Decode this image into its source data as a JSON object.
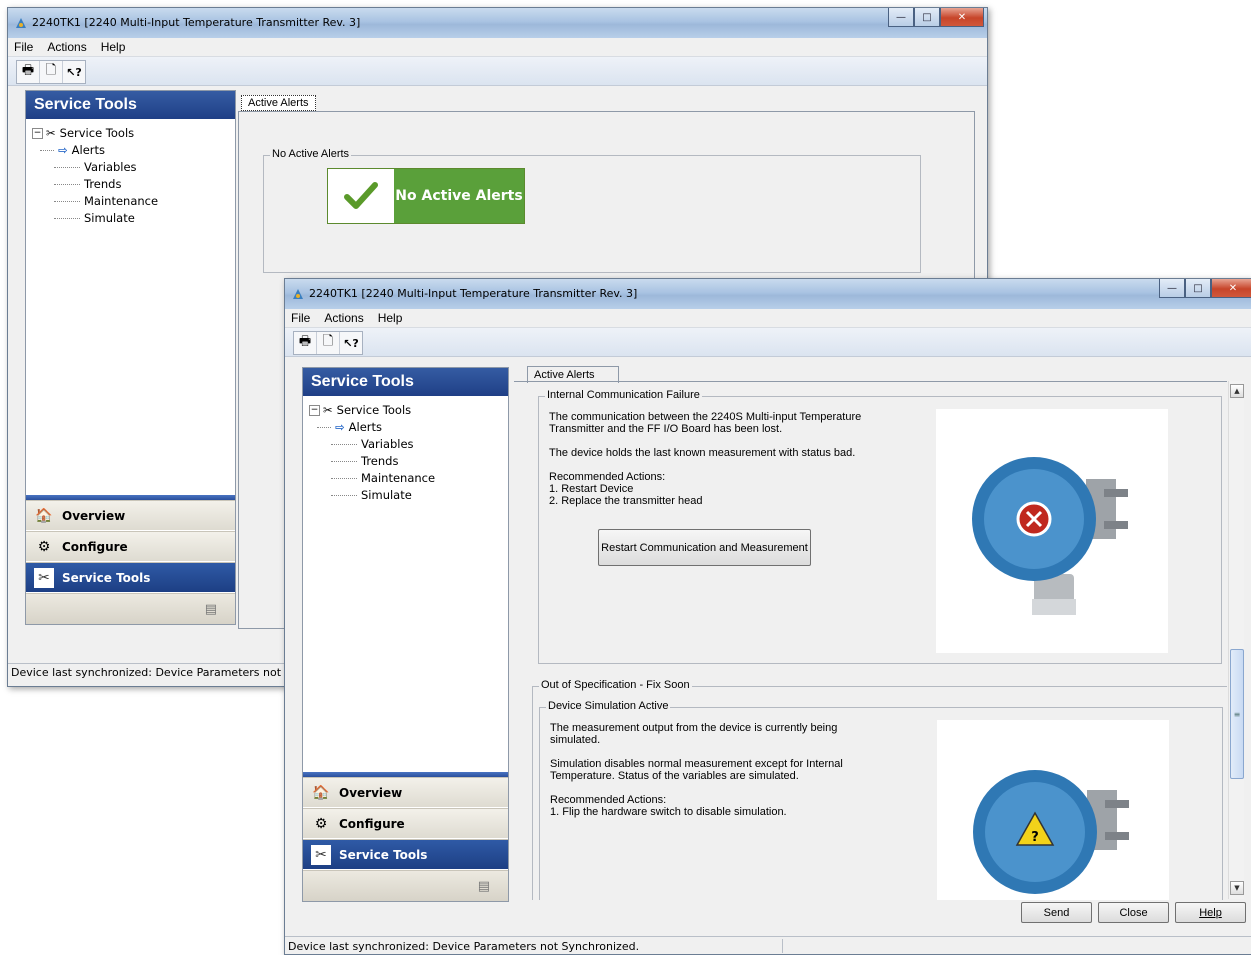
{
  "back_window": {
    "title": "2240TK1 [2240 Multi-Input Temperature Transmitter Rev. 3]",
    "menu": [
      "File",
      "Actions",
      "Help"
    ],
    "left_pane": {
      "header": "Service Tools",
      "tree_root": "Service Tools",
      "tree_items": [
        "Alerts",
        "Variables",
        "Trends",
        "Maintenance",
        "Simulate"
      ],
      "active_item": "Alerts"
    },
    "nav_buttons": [
      "Overview",
      "Configure",
      "Service Tools"
    ],
    "tab": "Active Alerts",
    "group_label": "No Active Alerts",
    "badge_text": "No Active Alerts",
    "status": "Device last synchronized: Device Parameters not Synchronized."
  },
  "front_window": {
    "title": "2240TK1 [2240 Multi-Input Temperature Transmitter Rev. 3]",
    "menu": [
      "File",
      "Actions",
      "Help"
    ],
    "left_pane": {
      "header": "Service Tools",
      "tree_root": "Service Tools",
      "tree_items": [
        "Alerts",
        "Variables",
        "Trends",
        "Maintenance",
        "Simulate"
      ],
      "active_item": "Alerts"
    },
    "nav_buttons": [
      "Overview",
      "Configure",
      "Service Tools"
    ],
    "tab": "Active Alerts",
    "alert1": {
      "group_label": "Internal Communication Failure",
      "text": "The communication between the 2240S Multi-input Temperature\nTransmitter and the FF I/O Board has been lost.\n\nThe device holds the last known measurement with status bad.\n\nRecommended Actions:\n1. Restart Device\n2. Replace the transmitter head",
      "button": "Restart Communication and Measurement"
    },
    "section2_label": "Out of Specification - Fix Soon",
    "alert2": {
      "group_label": "Device Simulation Active",
      "text": "The measurement output from the device is currently being\nsimulated.\n\nSimulation disables normal measurement except for Internal\nTemperature. Status of the variables are simulated.\n\nRecommended Actions:\n1. Flip the hardware switch to disable simulation."
    },
    "buttons": {
      "send": "Send",
      "close": "Close",
      "help": "Help"
    },
    "status": "Device last synchronized: Device Parameters not Synchronized."
  },
  "colors": {
    "header_blue": "#1f3f86",
    "ok_green": "#5aa03a",
    "error_red": "#c0281e",
    "warning_yellow": "#f2d21a",
    "device_blue": "#3f86bf"
  }
}
